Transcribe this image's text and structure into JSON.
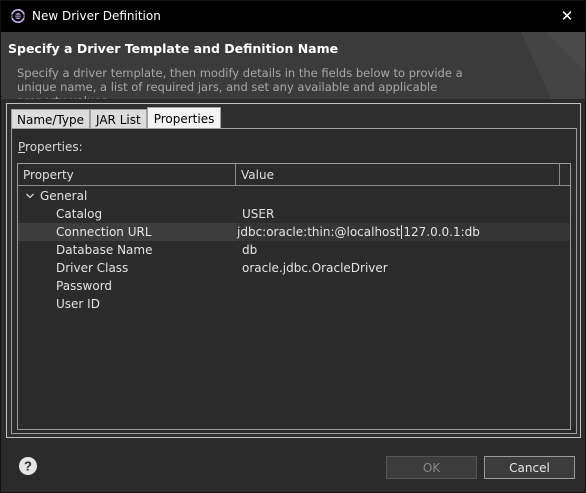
{
  "window": {
    "title": "New Driver Definition",
    "close_symbol": "✕"
  },
  "header": {
    "title": "Specify a Driver Template and Definition Name",
    "description": "Specify a driver template, then modify details in the fields below to provide a unique name, a list of required jars, and set any available and applicable property values."
  },
  "tabs": [
    {
      "label": "Name/Type",
      "active": false
    },
    {
      "label": "JAR List",
      "active": false
    },
    {
      "label": "Properties",
      "active": true
    }
  ],
  "properties": {
    "label_prefix": "P",
    "label_rest": "roperties:",
    "columns": [
      "Property",
      "Value"
    ],
    "group": "General",
    "rows": [
      {
        "name": "Catalog",
        "value": "USER"
      },
      {
        "name": "Connection URL",
        "value_before": "jdbc:oracle:thin:@localhost",
        "value_after": "127.0.0.1:db"
      },
      {
        "name": "Database Name",
        "value": "db"
      },
      {
        "name": "Driver Class",
        "value": "oracle.jdbc.OracleDriver"
      },
      {
        "name": "Password",
        "value": ""
      },
      {
        "name": "User ID",
        "value": ""
      }
    ]
  },
  "footer": {
    "ok_label": "OK",
    "ok_enabled": false,
    "cancel_label": "Cancel"
  },
  "colors": {
    "background": "#2b2b2b",
    "titlebar": "#000000",
    "header": "#3b3b3b"
  }
}
